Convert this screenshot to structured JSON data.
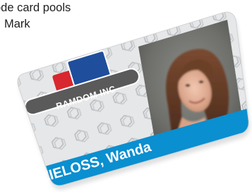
{
  "caption": {
    "line1": "ode card pools",
    "line2": "Mark"
  },
  "card": {
    "brand": "RAMDOM INC",
    "holder_name": "ZIELOSS, Wanda",
    "band_color": "#0a8fd0",
    "logo_colors": [
      "#d8272e",
      "#1f4e9c",
      "#5a5a5a"
    ]
  }
}
